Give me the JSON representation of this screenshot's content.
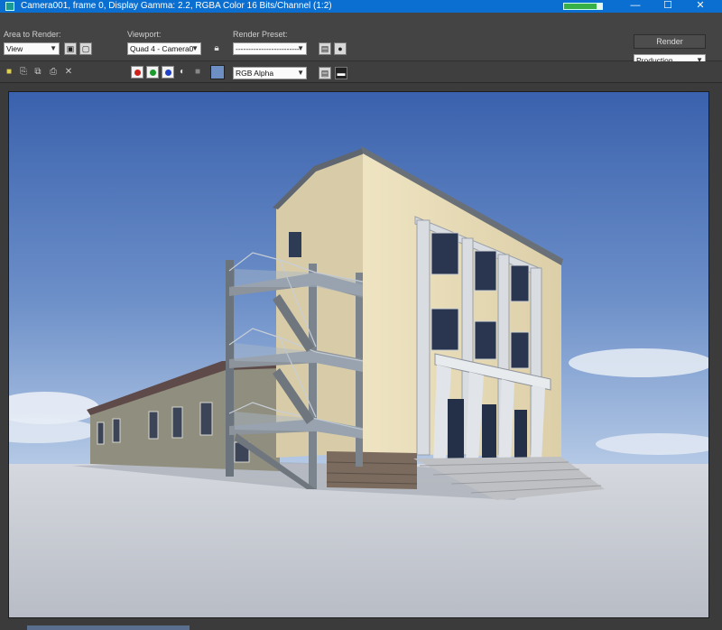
{
  "window": {
    "title": "Camera001, frame 0, Display Gamma: 2.2, RGBA Color 16 Bits/Channel (1:2)",
    "progress": 0.85,
    "controls": {
      "minimize": "—",
      "maximize": "☐",
      "close": "✕"
    }
  },
  "toolbar": {
    "area_label": "Area to Render:",
    "area_value": "View",
    "viewport_label": "Viewport:",
    "viewport_value": "Quad 4 - Camera0",
    "preset_label": "Render Preset:",
    "preset_value": "-------------------------",
    "render_label": "Render",
    "production_value": "Production",
    "channel_value": "RGB Alpha",
    "color_swatch": "#6e8fc4",
    "channel_colors": {
      "red": "#d0201c",
      "green": "#1c9a2c",
      "blue": "#2040c8"
    }
  },
  "icons": {
    "area_edit": "edit-region-icon",
    "area_auto": "auto-region-icon",
    "lock": "lock-icon",
    "preset_save": "save-preset-icon",
    "preset_env": "environment-icon",
    "save_image": "save-image-icon",
    "copy_image": "copy-image-icon",
    "clone_window": "clone-window-icon",
    "print_image": "print-icon",
    "clear_image": "clear-icon",
    "monochrome": "monochrome-icon",
    "alpha": "alpha-icon",
    "overlay": "overlay-icon",
    "display_toggle": "display-toggle-icon"
  },
  "colors": {
    "titlebar": "#0a6fd1",
    "sky_top": "#3d64b0",
    "sky_bottom": "#a9c2e2",
    "ground": "#c9ccd4",
    "wall": "#e6d9b6",
    "stone": "#7a6b5e"
  }
}
